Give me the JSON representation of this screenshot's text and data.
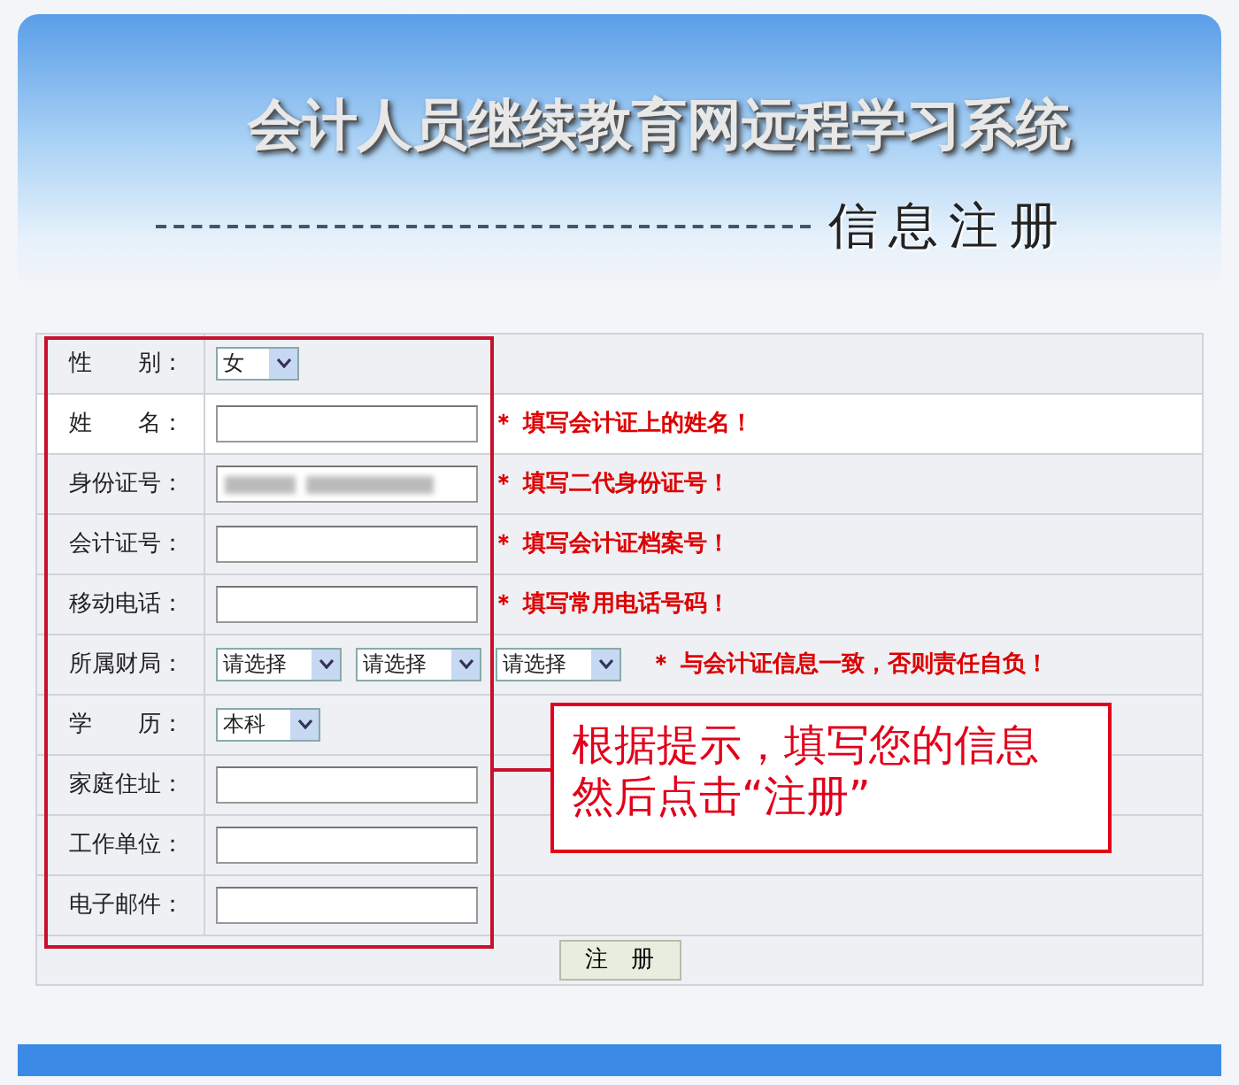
{
  "header": {
    "title": "会计人员继续教育网远程学习系统",
    "subtitle": "信息注册"
  },
  "rows": [
    {
      "label": "性　　别：",
      "kind": "select",
      "highlighted": false,
      "selects": [
        {
          "value": "女"
        }
      ]
    },
    {
      "label": "姓　　名：",
      "kind": "text",
      "highlighted": true,
      "hint": "＊ 填写会计证上的姓名！"
    },
    {
      "label": "身份证号：",
      "kind": "text",
      "highlighted": false,
      "redacted": true,
      "hint": "＊ 填写二代身份证号！"
    },
    {
      "label": "会计证号：",
      "kind": "text",
      "highlighted": false,
      "hint": "＊ 填写会计证档案号！"
    },
    {
      "label": "移动电话：",
      "kind": "text",
      "highlighted": false,
      "hint": "＊ 填写常用电话号码！"
    },
    {
      "label": "所属财局：",
      "kind": "select",
      "highlighted": false,
      "selects": [
        {
          "value": "请选择"
        },
        {
          "value": "请选择"
        },
        {
          "value": "请选择"
        }
      ],
      "hint": "＊ 与会计证信息一致，否则责任自负！"
    },
    {
      "label": "学　　历：",
      "kind": "select",
      "highlighted": false,
      "selects": [
        {
          "value": "本科"
        }
      ]
    },
    {
      "label": "家庭住址：",
      "kind": "text",
      "highlighted": false
    },
    {
      "label": "工作单位：",
      "kind": "text",
      "highlighted": false
    },
    {
      "label": "电子邮件：",
      "kind": "text",
      "highlighted": false
    }
  ],
  "submit": "注　册",
  "callout": {
    "lines": [
      "根据提示，填写您的信息",
      "然后点击“注册”"
    ]
  }
}
